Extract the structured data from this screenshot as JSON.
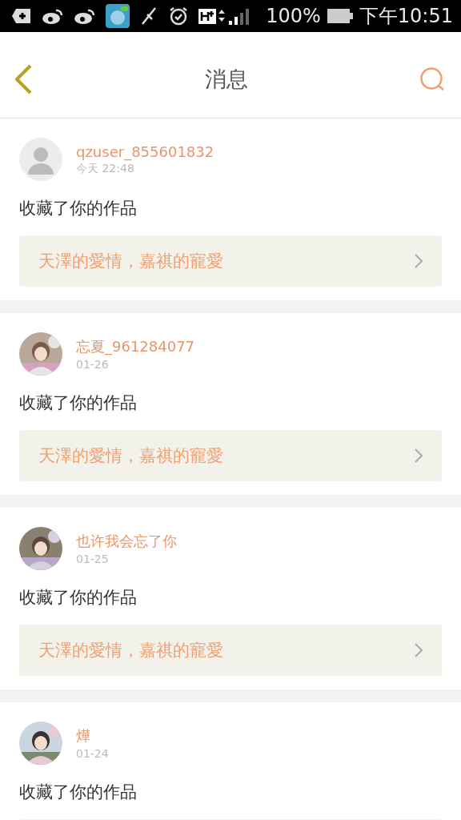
{
  "status_bar": {
    "battery": "100%",
    "time": "下午10:51"
  },
  "header": {
    "title": "消息"
  },
  "messages": [
    {
      "kind": "plain",
      "user": "qzuser_855601832",
      "time": "今天 22:48",
      "action": "收藏了你的作品",
      "work": "天澤的愛情，嘉祺的寵愛"
    },
    {
      "kind": "picture",
      "user": "忘夏_961284077",
      "time": "01-26",
      "action": "收藏了你的作品",
      "work": "天澤的愛情，嘉祺的寵愛"
    },
    {
      "kind": "picture",
      "user": "也许我会忘了你",
      "time": "01-25",
      "action": "收藏了你的作品",
      "work": "天澤的愛情，嘉祺的寵愛"
    },
    {
      "kind": "picture",
      "user": "燁",
      "time": "01-24",
      "action": "收藏了你的作品"
    }
  ]
}
